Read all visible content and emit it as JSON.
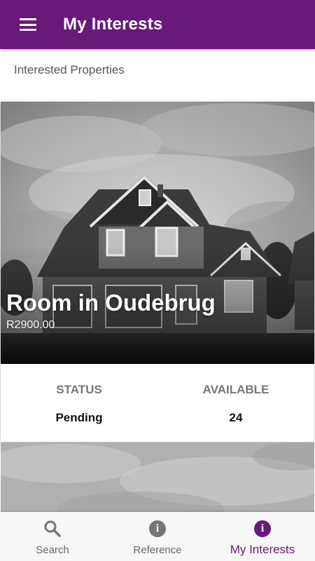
{
  "appbar": {
    "title": "My Interests",
    "menu_icon": "menu-icon"
  },
  "section_label": "Interested Properties",
  "property_card": {
    "title": "Room in Oudebrug",
    "price": "R2900.00",
    "status_label": "STATUS",
    "status_value": "Pending",
    "available_label": "AVAILABLE",
    "available_value": "24",
    "image": "house-photo"
  },
  "bottom_nav": {
    "items": [
      {
        "label": "Search",
        "icon": "search-icon",
        "active": false
      },
      {
        "label": "Reference",
        "icon": "info-icon",
        "active": false
      },
      {
        "label": "My Interests",
        "icon": "info-icon",
        "active": true
      }
    ]
  },
  "colors": {
    "primary": "#671a7a",
    "inactive": "#757575"
  }
}
